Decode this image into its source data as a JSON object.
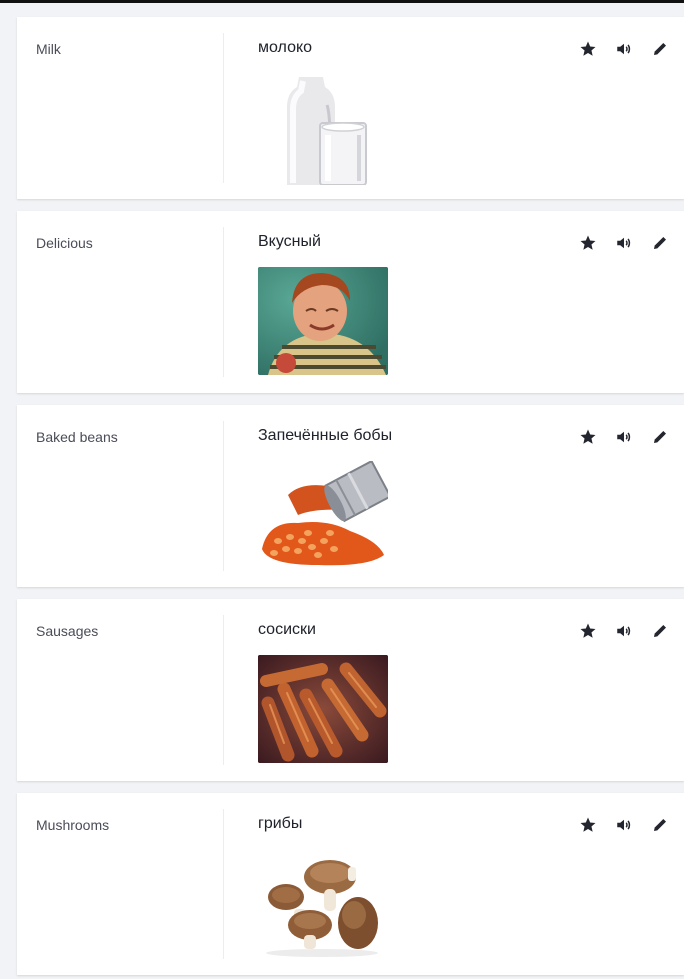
{
  "cards": [
    {
      "term": "Milk",
      "translation": "молоко",
      "image": "milk-bottle-and-glass-image"
    },
    {
      "term": "Delicious",
      "translation": "Вкусный",
      "image": "smiling-boy-eating-image"
    },
    {
      "term": "Baked beans",
      "translation": "Запечённые бобы",
      "image": "spilled-baked-beans-can-image"
    },
    {
      "term": "Sausages",
      "translation": "сосиски",
      "image": "sausages-on-tray-image"
    },
    {
      "term": "Mushrooms",
      "translation": "грибы",
      "image": "mushrooms-image"
    }
  ],
  "icons": {
    "favorite": "star-icon",
    "audio": "speaker-icon",
    "edit": "pencil-icon"
  },
  "colors": {
    "background": "#f2f3f6",
    "card": "#ffffff",
    "text": "#2a2c38",
    "icon": "#23252f"
  }
}
